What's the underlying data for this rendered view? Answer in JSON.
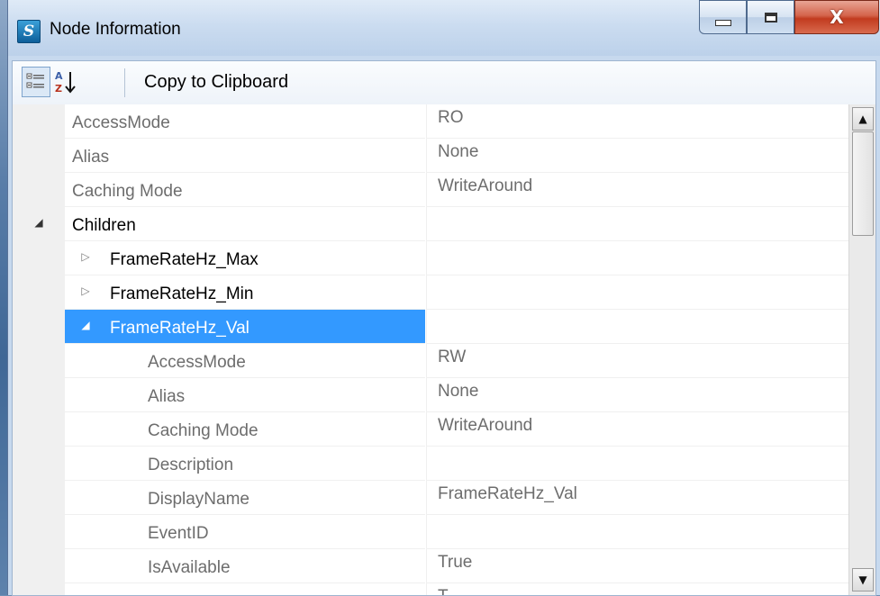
{
  "window": {
    "title": "Node Information",
    "app_icon": "s-logo-icon",
    "buttons": {
      "minimize": "minimize-icon",
      "maximize": "maximize-icon",
      "close": "X"
    }
  },
  "toolbar": {
    "categorized_icon": "categorized-icon",
    "alphabetical_icon": "sort-alpha-icon",
    "alphabetical_label": "A Z",
    "copy_label": "Copy to Clipboard"
  },
  "grid": {
    "rows": [
      {
        "name": "AccessMode",
        "value": "RO",
        "style": "gray"
      },
      {
        "name": "Alias",
        "value": "None",
        "style": "gray"
      },
      {
        "name": "Caching Mode",
        "value": "WriteAround",
        "style": "gray"
      },
      {
        "name": "Children",
        "value": "",
        "style": "black",
        "expander": "◢"
      },
      {
        "name": "FrameRateHz_Max",
        "value": "",
        "style": "black",
        "expander": "▷"
      },
      {
        "name": "FrameRateHz_Min",
        "value": "",
        "style": "black",
        "expander": "▷"
      },
      {
        "name": "FrameRateHz_Val",
        "value": "",
        "style": "selected",
        "expander": "◢"
      },
      {
        "name": "AccessMode",
        "value": "RW",
        "style": "gray"
      },
      {
        "name": "Alias",
        "value": "None",
        "style": "gray"
      },
      {
        "name": "Caching Mode",
        "value": "WriteAround",
        "style": "gray"
      },
      {
        "name": "Description",
        "value": "",
        "style": "gray"
      },
      {
        "name": "DisplayName",
        "value": "FrameRateHz_Val",
        "style": "gray"
      },
      {
        "name": "EventID",
        "value": "",
        "style": "gray"
      },
      {
        "name": "IsAvailable",
        "value": "True",
        "style": "gray"
      },
      {
        "name": "",
        "value": "T",
        "style": "gray"
      }
    ]
  },
  "scrollbar": {
    "up_arrow": "▲",
    "down_arrow": "▼"
  }
}
